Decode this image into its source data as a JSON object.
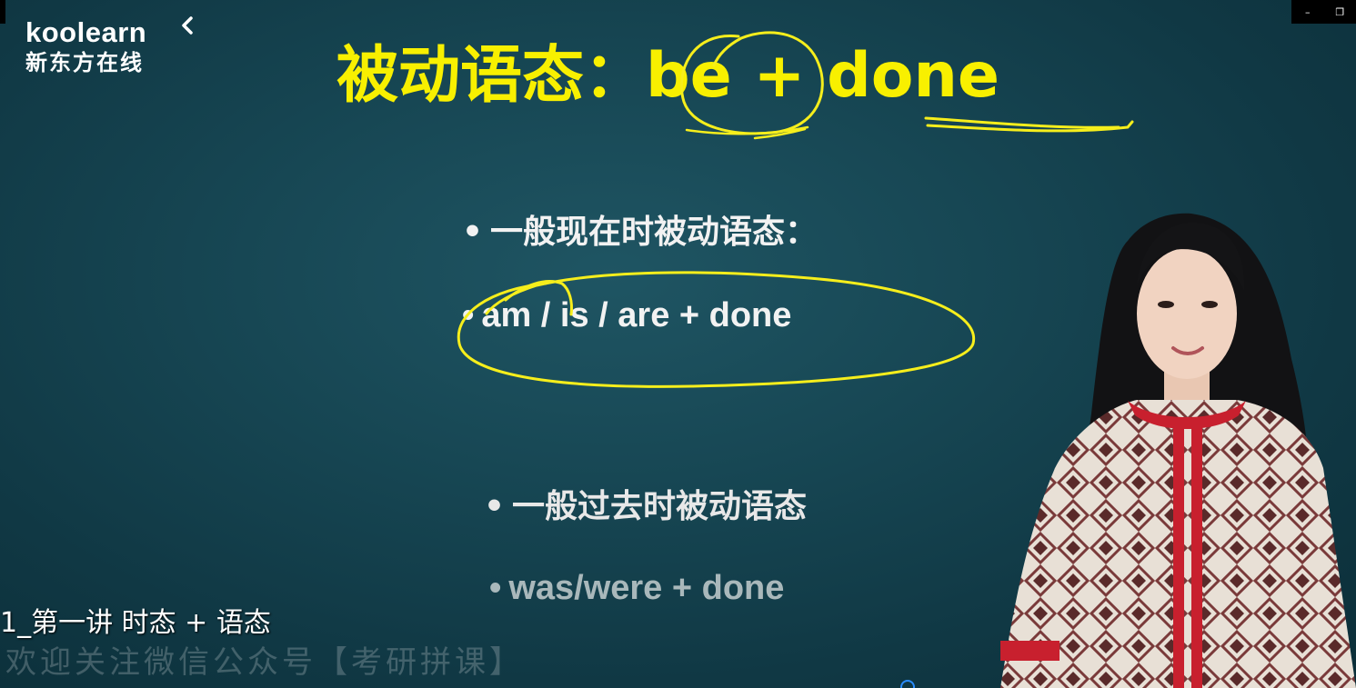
{
  "logo": {
    "en": "koolearn",
    "cn": "新东方在线"
  },
  "slide": {
    "title": "被动语态：be + done",
    "bullets": [
      "一般现在时被动语态：",
      "am / is / are + done",
      "一般过去时被动语态",
      "was/were + done"
    ],
    "bullet_marker": "•"
  },
  "video": {
    "subtitle": "1_第一讲 时态 + 语态",
    "watermark": "欢迎关注微信公众号【考研拼课】"
  },
  "window_controls": {
    "minimize": "–",
    "restore": "❐"
  },
  "colors": {
    "title": "#f8f000",
    "annotation": "#f6ee1c",
    "background": "#174754",
    "text": "#f2f2f2"
  }
}
